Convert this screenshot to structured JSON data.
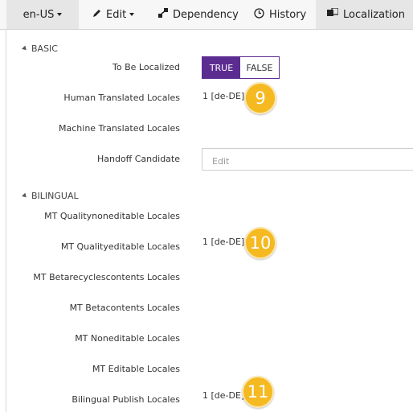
{
  "toolbar": {
    "language": "en-US",
    "edit": "Edit",
    "dependency": "Dependency",
    "history": "History",
    "localization": "Localization"
  },
  "basic": {
    "header": "BASIC",
    "to_be_localized_label": "To Be Localized",
    "toggle_true": "TRUE",
    "toggle_false": "FALSE",
    "toggle_selected": "TRUE",
    "human_translated_label": "Human Translated Locales",
    "human_translated_value": "1 [de-DE]",
    "machine_translated_label": "Machine Translated Locales",
    "handoff_label": "Handoff Candidate",
    "handoff_placeholder": "Edit"
  },
  "bilingual": {
    "header": "BILINGUAL",
    "rows": [
      {
        "label": "MT Qualitynoneditable Locales",
        "value": ""
      },
      {
        "label": "MT Qualityeditable Locales",
        "value": "1 [de-DE]"
      },
      {
        "label": "MT Betarecyclescontents Locales",
        "value": ""
      },
      {
        "label": "MT Betacontents Locales",
        "value": ""
      },
      {
        "label": "MT Noneditable Locales",
        "value": ""
      },
      {
        "label": "MT Editable Locales",
        "value": ""
      },
      {
        "label": "Bilingual Publish Locales",
        "value": "1 [de-DE]"
      }
    ]
  },
  "badges": [
    "9",
    "10",
    "11"
  ],
  "colors": {
    "accent": "#5c2d91",
    "badge": "#f5b921"
  }
}
